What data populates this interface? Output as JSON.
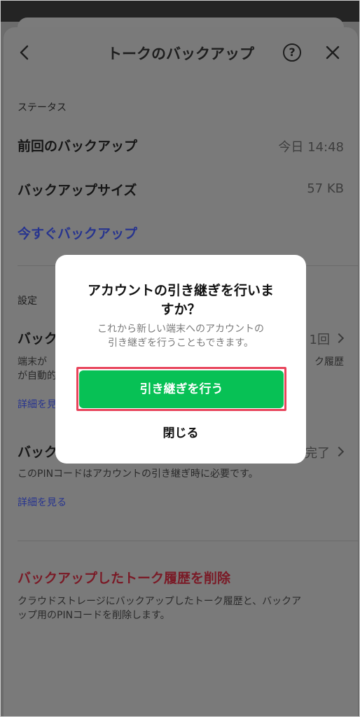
{
  "header": {
    "title": "トークのバックアップ",
    "help_glyph": "?"
  },
  "status": {
    "section_label": "ステータス",
    "last_backup_label": "前回のバックアップ",
    "last_backup_value": "今日 14:48",
    "size_label": "バックアップサイズ",
    "size_value": "57 KB",
    "backup_now": "今すぐバックアップ"
  },
  "settings": {
    "section_label": "設定",
    "row1_title_visible": "バック",
    "row1_value_visible": "1回",
    "row1_desc_line1_left": "端末が",
    "row1_desc_line1_right": "ク履歴",
    "row1_desc_line2": "が自動的",
    "row1_link_visible": "詳細を見",
    "row2_title_visible": "バック",
    "row2_value_visible": "完了",
    "pin_desc": "このPINコードはアカウントの引き継ぎ時に必要です。",
    "pin_link": "詳細を見る"
  },
  "delete": {
    "title": "バックアップしたトーク履歴を削除",
    "desc_line1": "クラウドストレージにバックアップしたトーク履歴と、バックア",
    "desc_line2": "ップ用のPINコードを削除します。"
  },
  "dialog": {
    "title_line1": "アカウントの引き継ぎを行いま",
    "title_line2": "すか？",
    "message_line1": "これから新しい端末へのアカウントの",
    "message_line2": "引き継ぎを行うこともできます。",
    "primary_button": "引き継ぎを行う",
    "close_button": "閉じる"
  },
  "colors": {
    "primary": "#07c155",
    "highlight": "#e8435a",
    "link": "#27348f",
    "danger": "#7a1a26"
  }
}
